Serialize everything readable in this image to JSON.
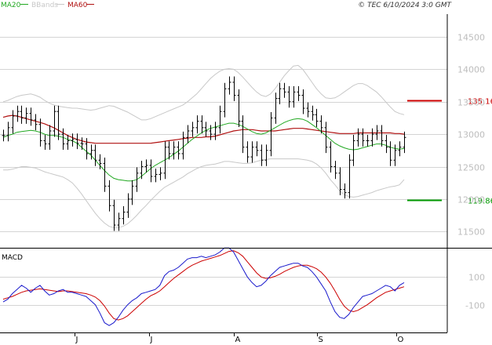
{
  "header": {
    "legend": [
      {
        "label": "MA20",
        "color": "#21a821"
      },
      {
        "label": "BBands",
        "color": "#c8c8c8"
      },
      {
        "label": "MA60",
        "color": "#b01010"
      }
    ],
    "copyright": "© TEC 6/10/2024 3:0 GMT"
  },
  "chart_data": [
    {
      "type": "ohlc",
      "title": "",
      "ylim": [
        11250,
        14850
      ],
      "y_ticks": [
        11500,
        12000,
        12500,
        13000,
        13500,
        14000,
        14500
      ],
      "y_tick_labels": [
        "11500",
        "12000",
        "12500",
        "13000",
        "13500",
        "14000",
        "14500"
      ],
      "x_tick_labels": [
        "J",
        "J",
        "A",
        "S",
        "O"
      ],
      "grid": true,
      "levels": [
        {
          "label": "135.16",
          "value": 13516,
          "color": "#cc0000"
        },
        {
          "label": "119.86",
          "value": 11986,
          "color": "#009900"
        }
      ],
      "colors": {
        "price": "#000000",
        "ma20": "#21a821",
        "ma60": "#b01010",
        "bbands": "#c8c8c8"
      },
      "series": [
        {
          "name": "Price (close)",
          "values": [
            12980,
            13100,
            13280,
            13350,
            13250,
            13320,
            13220,
            13150,
            12900,
            12850,
            13050,
            13350,
            13000,
            12850,
            12900,
            12920,
            12860,
            12850,
            12700,
            12750,
            12600,
            12550,
            12200,
            11900,
            11600,
            11700,
            11800,
            12000,
            12200,
            12400,
            12500,
            12520,
            12350,
            12380,
            12400,
            12800,
            12700,
            12800,
            12700,
            12950,
            13050,
            13100,
            13200,
            13100,
            13050,
            13000,
            13100,
            13350,
            13700,
            13800,
            13600,
            13200,
            12800,
            12650,
            12800,
            12750,
            12600,
            12750,
            13250,
            13550,
            13700,
            13650,
            13500,
            13650,
            13600,
            13400,
            13350,
            13300,
            13200,
            13100,
            12800,
            12500,
            12400,
            12150,
            12100,
            12600,
            12900,
            13000,
            12900,
            12900,
            13000,
            13050,
            12900,
            12800,
            12600,
            12750,
            12800,
            12950
          ]
        },
        {
          "name": "MA20",
          "values": [
            12950,
            12980,
            13000,
            13030,
            13040,
            13050,
            13060,
            13050,
            13030,
            13000,
            12980,
            12980,
            12970,
            12950,
            12920,
            12900,
            12860,
            12800,
            12740,
            12680,
            12600,
            12520,
            12440,
            12370,
            12320,
            12300,
            12290,
            12280,
            12280,
            12300,
            12350,
            12410,
            12470,
            12520,
            12560,
            12600,
            12640,
            12690,
            12740,
            12800,
            12860,
            12920,
            12970,
            13020,
            13060,
            13090,
            13110,
            13130,
            13150,
            13170,
            13170,
            13150,
            13120,
            13080,
            13040,
            13010,
            13000,
            13020,
            13060,
            13100,
            13140,
            13180,
            13210,
            13230,
            13240,
            13230,
            13200,
            13150,
            13100,
            13040,
            12980,
            12920,
            12860,
            12820,
            12790,
            12770,
            12760,
            12770,
            12790,
            12810,
            12830,
            12850,
            12850,
            12830,
            12800,
            12780,
            12770,
            12780
          ]
        },
        {
          "name": "MA60",
          "values": [
            13260,
            13280,
            13290,
            13280,
            13260,
            13240,
            13220,
            13200,
            13180,
            13160,
            13130,
            13100,
            13060,
            13020,
            12980,
            12950,
            12920,
            12900,
            12880,
            12870,
            12860,
            12860,
            12860,
            12860,
            12860,
            12860,
            12860,
            12860,
            12860,
            12860,
            12860,
            12860,
            12860,
            12870,
            12880,
            12890,
            12900,
            12910,
            12920,
            12930,
            12940,
            12950,
            12950,
            12950,
            12960,
            12960,
            12970,
            12990,
            13010,
            13030,
            13050,
            13060,
            13070,
            13070,
            13070,
            13060,
            13050,
            13050,
            13050,
            13050,
            13060,
            13070,
            13080,
            13090,
            13090,
            13090,
            13080,
            13070,
            13060,
            13050,
            13040,
            13030,
            13020,
            13010,
            13010,
            13010,
            13010,
            13020,
            13020,
            13020,
            13020,
            13020,
            13020,
            13020,
            13020,
            13010,
            13010,
            13000
          ]
        },
        {
          "name": "BB upper",
          "values": [
            13500,
            13520,
            13550,
            13580,
            13600,
            13610,
            13620,
            13600,
            13570,
            13520,
            13480,
            13450,
            13430,
            13420,
            13410,
            13400,
            13400,
            13390,
            13380,
            13370,
            13380,
            13400,
            13420,
            13440,
            13430,
            13400,
            13370,
            13340,
            13300,
            13260,
            13220,
            13220,
            13240,
            13270,
            13300,
            13330,
            13360,
            13390,
            13420,
            13450,
            13500,
            13560,
            13620,
            13700,
            13780,
            13860,
            13920,
            13970,
            14000,
            14010,
            14000,
            13950,
            13880,
            13800,
            13720,
            13650,
            13600,
            13580,
            13620,
            13700,
            13800,
            13900,
            13980,
            14050,
            14060,
            14000,
            13900,
            13800,
            13700,
            13620,
            13560,
            13550,
            13560,
            13600,
            13650,
            13700,
            13750,
            13780,
            13780,
            13750,
            13700,
            13650,
            13580,
            13500,
            13420,
            13350,
            13320,
            13300
          ]
        },
        {
          "name": "BB lower",
          "values": [
            12450,
            12450,
            12460,
            12480,
            12500,
            12500,
            12490,
            12480,
            12450,
            12420,
            12400,
            12380,
            12360,
            12340,
            12300,
            12250,
            12170,
            12080,
            11980,
            11880,
            11780,
            11700,
            11630,
            11580,
            11560,
            11560,
            11580,
            11620,
            11680,
            11750,
            11830,
            11900,
            11980,
            12050,
            12120,
            12180,
            12220,
            12260,
            12300,
            12340,
            12390,
            12430,
            12470,
            12500,
            12520,
            12530,
            12540,
            12560,
            12580,
            12580,
            12570,
            12560,
            12550,
            12550,
            12560,
            12580,
            12600,
            12610,
            12620,
            12620,
            12620,
            12620,
            12620,
            12620,
            12620,
            12610,
            12600,
            12580,
            12540,
            12480,
            12400,
            12300,
            12220,
            12130,
            12070,
            12040,
            12030,
            12040,
            12060,
            12080,
            12100,
            12130,
            12150,
            12170,
            12190,
            12200,
            12220,
            12300
          ]
        }
      ]
    },
    {
      "type": "line",
      "title": "MACD",
      "ylim": [
        -300,
        300
      ],
      "y_ticks": [
        100,
        -100
      ],
      "y_tick_labels": [
        "100",
        "-100"
      ],
      "series": [
        {
          "name": "MACD",
          "values": [
            -80,
            -60,
            -20,
            10,
            40,
            20,
            -10,
            20,
            40,
            0,
            -30,
            -20,
            0,
            10,
            -10,
            -10,
            -20,
            -30,
            -40,
            -70,
            -100,
            -160,
            -230,
            -250,
            -230,
            -190,
            -140,
            -100,
            -70,
            -50,
            -20,
            -10,
            0,
            10,
            40,
            110,
            140,
            150,
            170,
            200,
            230,
            240,
            240,
            250,
            240,
            250,
            260,
            280,
            310,
            310,
            280,
            220,
            160,
            100,
            60,
            30,
            40,
            70,
            110,
            140,
            170,
            180,
            190,
            200,
            200,
            180,
            170,
            140,
            100,
            50,
            0,
            -80,
            -150,
            -190,
            -200,
            -170,
            -120,
            -80,
            -40,
            -30,
            -20,
            0,
            20,
            40,
            30,
            0,
            40,
            60
          ]
        },
        {
          "name": "Signal",
          "values": [
            -60,
            -50,
            -40,
            -25,
            -10,
            0,
            5,
            10,
            15,
            10,
            5,
            0,
            -5,
            0,
            0,
            -5,
            -10,
            -15,
            -20,
            -30,
            -45,
            -70,
            -110,
            -160,
            -200,
            -210,
            -200,
            -180,
            -150,
            -120,
            -90,
            -60,
            -35,
            -20,
            0,
            30,
            60,
            90,
            115,
            140,
            165,
            185,
            200,
            215,
            225,
            235,
            245,
            255,
            270,
            285,
            290,
            275,
            250,
            210,
            170,
            130,
            100,
            90,
            95,
            105,
            120,
            140,
            155,
            170,
            180,
            185,
            185,
            175,
            160,
            135,
            100,
            55,
            0,
            -60,
            -110,
            -140,
            -150,
            -140,
            -120,
            -100,
            -75,
            -50,
            -30,
            -10,
            0,
            10,
            20,
            30
          ]
        }
      ]
    }
  ]
}
